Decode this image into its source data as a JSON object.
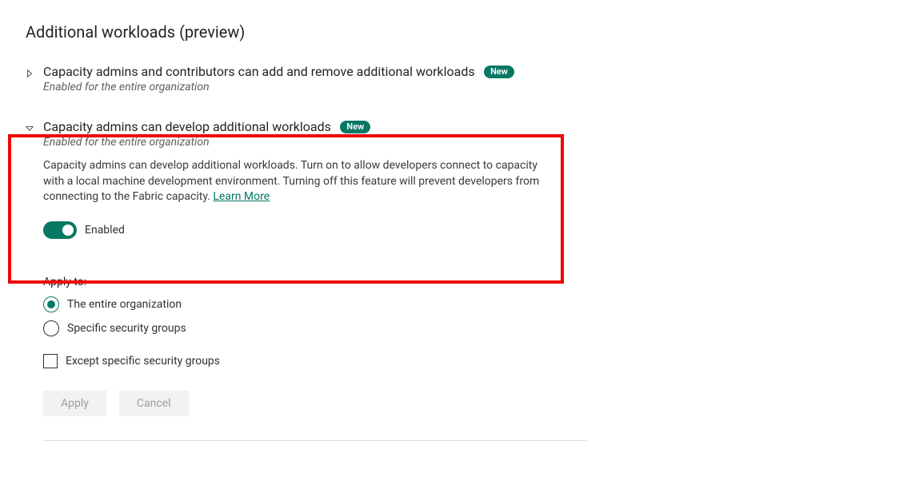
{
  "section": {
    "title": "Additional workloads (preview)"
  },
  "settings": [
    {
      "title": "Capacity admins and contributors can add and remove additional workloads",
      "badge": "New",
      "subtitle": "Enabled for the entire organization",
      "expanded": false
    },
    {
      "title": "Capacity admins can develop additional workloads",
      "badge": "New",
      "subtitle": "Enabled for the entire organization",
      "expanded": true,
      "description": "Capacity admins can develop additional workloads. Turn on to allow developers connect to capacity with a local machine development environment. Turning off this feature will prevent developers from connecting to the Fabric capacity. ",
      "learn_more_label": "Learn More",
      "toggle": {
        "state": true,
        "label": "Enabled"
      }
    }
  ],
  "apply_to": {
    "heading": "Apply to:",
    "options": [
      {
        "label": "The entire organization",
        "selected": true
      },
      {
        "label": "Specific security groups",
        "selected": false
      }
    ],
    "except_label": "Except specific security groups",
    "except_checked": false
  },
  "buttons": {
    "apply": "Apply",
    "cancel": "Cancel"
  },
  "colors": {
    "accent": "#067864",
    "highlight": "#ef0606"
  }
}
